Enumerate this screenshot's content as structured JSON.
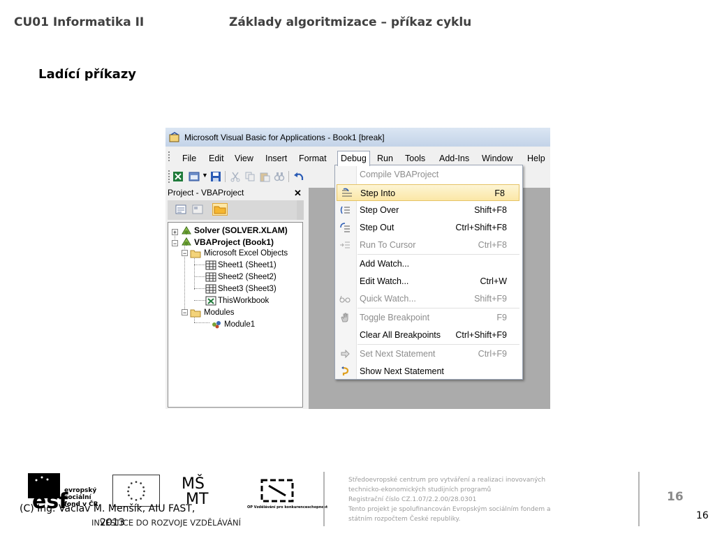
{
  "header": {
    "course": "CU01 Informatika II",
    "topic": "Základy algoritmizace – příkaz cyklu"
  },
  "section_title": "Ladící příkazy",
  "vba": {
    "window_title": "Microsoft Visual Basic for Applications - Book1 [break]",
    "menus": [
      "File",
      "Edit",
      "View",
      "Insert",
      "Format",
      "Debug",
      "Run",
      "Tools",
      "Add-Ins",
      "Window",
      "Help"
    ],
    "active_menu": "Debug",
    "project_pane": {
      "title": "Project - VBAProject",
      "close": "✕",
      "tree": [
        {
          "label": "Solver (SOLVER.XLAM)"
        },
        {
          "label": "VBAProject (Book1)"
        },
        {
          "label": "Microsoft Excel Objects"
        },
        {
          "label": "Sheet1 (Sheet1)"
        },
        {
          "label": "Sheet2 (Sheet2)"
        },
        {
          "label": "Sheet3 (Sheet3)"
        },
        {
          "label": "ThisWorkbook"
        },
        {
          "label": "Modules"
        },
        {
          "label": "Module1"
        }
      ]
    },
    "debug_menu": [
      {
        "label": "Compile VBAProject",
        "shortcut": "",
        "disabled": true
      },
      {
        "label": "Step Into",
        "shortcut": "F8",
        "highlighted": true
      },
      {
        "label": "Step Over",
        "shortcut": "Shift+F8"
      },
      {
        "label": "Step Out",
        "shortcut": "Ctrl+Shift+F8"
      },
      {
        "label": "Run To Cursor",
        "shortcut": "Ctrl+F8",
        "disabled": true
      },
      {
        "label": "Add Watch...",
        "shortcut": ""
      },
      {
        "label": "Edit Watch...",
        "shortcut": "Ctrl+W"
      },
      {
        "label": "Quick Watch...",
        "shortcut": "Shift+F9",
        "disabled": true
      },
      {
        "label": "Toggle Breakpoint",
        "shortcut": "F9",
        "disabled": true
      },
      {
        "label": "Clear All Breakpoints",
        "shortcut": "Ctrl+Shift+F9"
      },
      {
        "label": "Set Next Statement",
        "shortcut": "Ctrl+F9",
        "disabled": true
      },
      {
        "label": "Show Next Statement",
        "shortcut": ""
      }
    ]
  },
  "footer": {
    "esf_text": "evropský sociální fond v ČR",
    "investice": "INVESTICE DO ROZVOJE VZDĚLÁVÁNÍ",
    "op_text": "OP Vzdělávání pro konkurenceschopnost",
    "copyright": "(C) Ing. Václav M. Menšík, AIU FAST,",
    "copyright_year": "2013",
    "info_lines": [
      "Středoevropské centrum pro vytváření a realizaci inovovaných",
      "technicko-ekonomických studijních programů",
      "Registrační číslo CZ.1.07/2.2.00/28.0301",
      "Tento projekt je spolufinancován Evropským sociálním fondem a",
      "státním rozpočtem České republiky."
    ],
    "slide_number_big": "16",
    "slide_number": "16"
  }
}
